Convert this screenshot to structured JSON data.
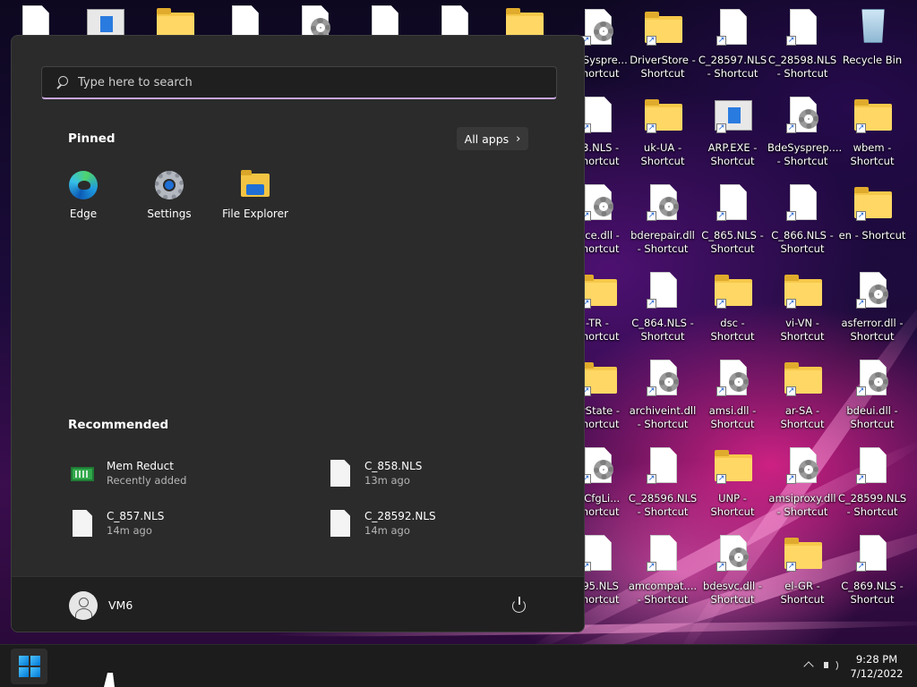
{
  "start_menu": {
    "search_placeholder": "Type here to search",
    "pinned_title": "Pinned",
    "all_apps_label": "All apps",
    "pinned": [
      {
        "label": "Edge"
      },
      {
        "label": "Settings"
      },
      {
        "label": "File Explorer"
      }
    ],
    "recommended_title": "Recommended",
    "recommended": [
      {
        "name": "Mem Reduct",
        "sub": "Recently added"
      },
      {
        "name": "C_858.NLS",
        "sub": "13m ago"
      },
      {
        "name": "C_857.NLS",
        "sub": "14m ago"
      },
      {
        "name": "C_28592.NLS",
        "sub": "14m ago"
      }
    ],
    "user_name": "VM6"
  },
  "desktop": {
    "icons": [
      {
        "label": "ideSyspre... Shortcut"
      },
      {
        "label": "DriverStore - Shortcut"
      },
      {
        "label": "C_28597.NLS - Shortcut"
      },
      {
        "label": "C_28598.NLS - Shortcut"
      },
      {
        "label": "Recycle Bin"
      },
      {
        "label": "63.NLS - Shortcut"
      },
      {
        "label": "uk-UA - Shortcut"
      },
      {
        "label": "ARP.EXE - Shortcut"
      },
      {
        "label": "BdeSysprep.... - Shortcut"
      },
      {
        "label": "wbem - Shortcut"
      },
      {
        "label": "face.dll - Shortcut"
      },
      {
        "label": "bderepair.dll - Shortcut"
      },
      {
        "label": "C_865.NLS - Shortcut"
      },
      {
        "label": "C_866.NLS - Shortcut"
      },
      {
        "label": "en - Shortcut"
      },
      {
        "label": "-TR - Shortcut"
      },
      {
        "label": "C_864.NLS - Shortcut"
      },
      {
        "label": "dsc - Shortcut"
      },
      {
        "label": "vi-VN - Shortcut"
      },
      {
        "label": "asferror.dll - Shortcut"
      },
      {
        "label": "erState - Shortcut"
      },
      {
        "label": "archiveint.dll - Shortcut"
      },
      {
        "label": "amsi.dll - Shortcut"
      },
      {
        "label": "ar-SA - Shortcut"
      },
      {
        "label": "bdeui.dll - Shortcut"
      },
      {
        "label": "ldCfgLi... Shortcut"
      },
      {
        "label": "C_28596.NLS - Shortcut"
      },
      {
        "label": "UNP - Shortcut"
      },
      {
        "label": "amsiproxy.dll - Shortcut"
      },
      {
        "label": "C_28599.NLS - Shortcut"
      },
      {
        "label": "595.NLS Shortcut"
      },
      {
        "label": "amcompat.... - Shortcut"
      },
      {
        "label": "bdesvc.dll - Shortcut"
      },
      {
        "label": "el-GR - Shortcut"
      },
      {
        "label": "C_869.NLS - Shortcut"
      }
    ]
  },
  "taskbar": {
    "time": "9:28 PM",
    "date": "7/12/2022"
  },
  "icon_names": [
    "search-icon",
    "chevron-right-icon",
    "edge-icon",
    "settings-icon",
    "file-explorer-icon",
    "power-icon",
    "user-icon",
    "windows-icon",
    "volume-icon",
    "chevron-up-icon"
  ]
}
